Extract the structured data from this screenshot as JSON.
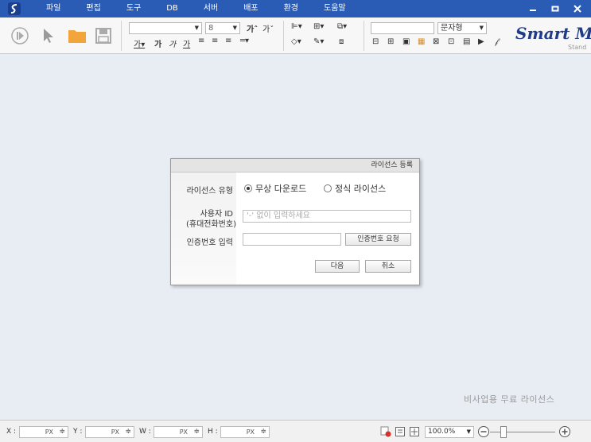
{
  "menu": {
    "items": [
      "파일",
      "편집",
      "도구",
      "DB",
      "서버",
      "배포",
      "환경",
      "도움말"
    ]
  },
  "toolbar": {
    "font_size_value": "8",
    "text_type_value": "문자형",
    "brand_name": "Smart Mak",
    "brand_sub": "Stand"
  },
  "dialog": {
    "title": "라이선스 등록",
    "license_type_label": "라이선스 유형",
    "option_free": "무상 다운로드",
    "option_official": "정식 라이선스",
    "user_id_label": "사용자 ID",
    "user_id_sublabel": "(휴대전화번호)",
    "user_id_placeholder": "'-' 없이 입력하세요",
    "auth_label": "인증번호 입력",
    "auth_value": "",
    "auth_request_button": "인증번호 요청",
    "next_button": "다음",
    "cancel_button": "취소"
  },
  "watermark": "비사업용 무료 라이선스",
  "statusbar": {
    "x_label": "X :",
    "y_label": "Y :",
    "w_label": "W :",
    "h_label": "H :",
    "unit": "PX",
    "zoom_value": "100.0%"
  },
  "colors": {
    "titlebar": "#2a5bb5",
    "brand": "#1f3c88"
  }
}
